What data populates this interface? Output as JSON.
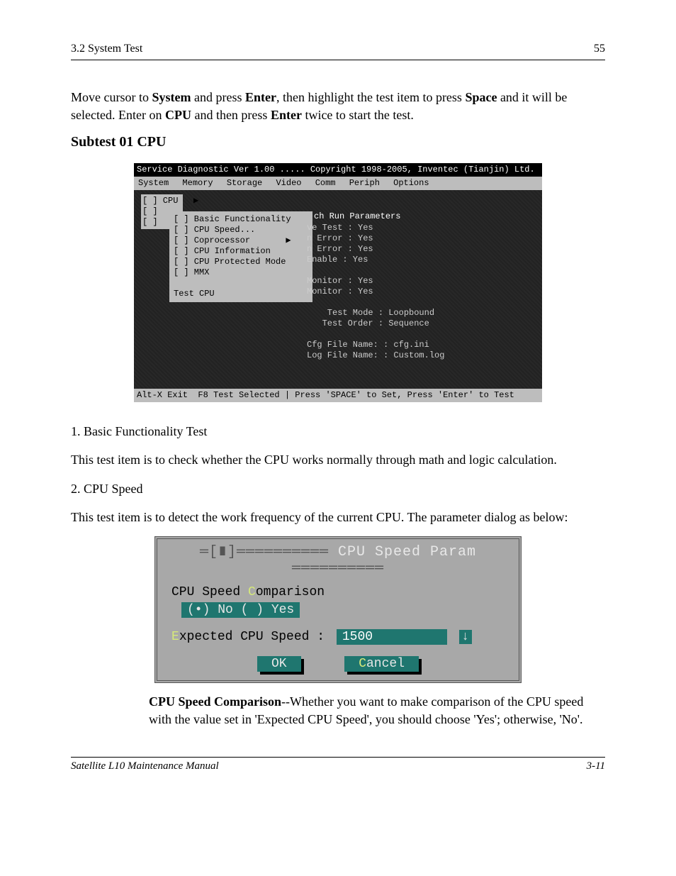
{
  "header": {
    "left": "3.2 System Test",
    "right": "55"
  },
  "intro": {
    "line1_pre": "Move cursor to ",
    "line1_b1": "System",
    "line1_mid": " and press ",
    "line1_b2": "Enter",
    "line1_post": ", then highlight the test item to press ",
    "line2_b1": "Space",
    "line2_mid": " and it will be selected. Enter on ",
    "line2_b2": "CPU",
    "line2_mid2": " and then press ",
    "line2_b3": "Enter",
    "line2_post": " twice to start the test."
  },
  "heading1": "Subtest 01 CPU",
  "screenshot1": {
    "title": "Service Diagnostic Ver 1.00 ..... Copyright 1998-2005, Inventec (Tianjin) Ltd.",
    "menubar": [
      "System",
      "Memory",
      "Storage",
      "Video",
      "Comm",
      "Periph",
      "Options"
    ],
    "left_list": "[ ] CPU   ▶\n[ ]\n[ ]",
    "submenu": "[ ] Basic Functionality\n[ ] CPU Speed...\n[ ] Coprocessor       ▶\n[ ] CPU Information\n[ ] CPU Protected Mode\n[ ] MMX\n\nTest CPU",
    "panel_title": "ch Run Parameters",
    "panel": "ve Test : Yes\nn Error : Yes\nn Error : Yes\nEnable : Yes\n\nMonitor : Yes\nMonitor : Yes\n\n    Test Mode : Loopbound\n   Test Order : Sequence\n\nCfg File Name: : cfg.ini\nLog File Name: : Custom.log",
    "status": "Alt-X Exit  F8 Test Selected | Press 'SPACE' to Set, Press 'Enter' to Test"
  },
  "body": {
    "p1": "1. Basic Functionality Test",
    "p2": "This test item is to check whether the CPU works normally through math and logic calculation.",
    "p3": "2. CPU Speed",
    "p4": "This test item is to detect the work frequency of the current CPU. The parameter dialog as below:"
  },
  "dialog": {
    "title": "CPU Speed Param",
    "row1_label": "CPU Speed ",
    "row1_hot": "C",
    "row1_rest": "omparison",
    "row1_sel": "(•) No   ( ) Yes",
    "row2_hot": "E",
    "row2_rest": "xpected CPU Speed :",
    "row2_val": "1500",
    "spin": "↓",
    "ok": "OK",
    "cancel_hot": "C",
    "cancel_rest": "ancel"
  },
  "post": {
    "lead": "CPU Speed Comparison",
    "lead_post": "--Whether you want to make comparison of the CPU speed with the value set in 'Expected CPU Speed', you should choose 'Yes'; otherwise, 'No'."
  },
  "footer": {
    "left": "Satellite L10 Maintenance Manual",
    "right": "3-11"
  }
}
